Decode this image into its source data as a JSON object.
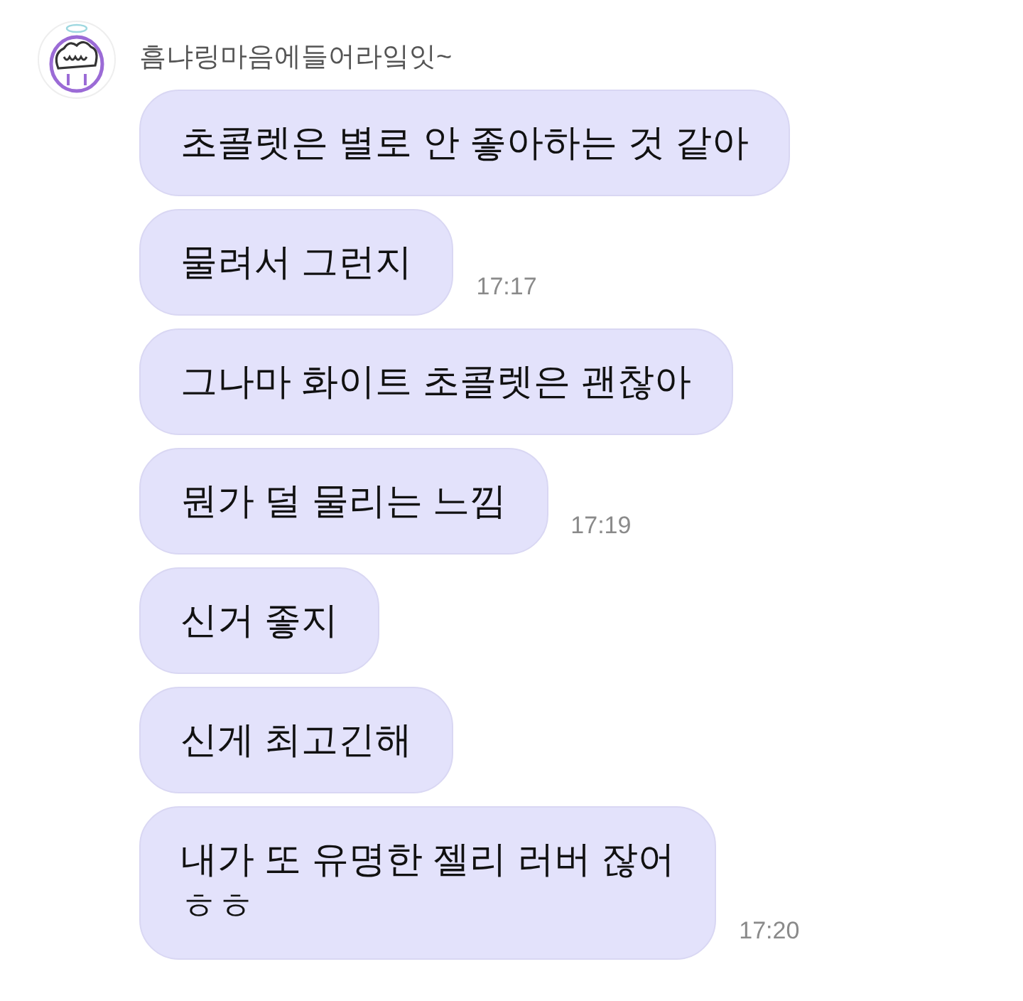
{
  "sender": {
    "name": "흠냐링마음에들어라잌잇~"
  },
  "messages": [
    {
      "text": "초콜렛은 별로 안 좋아하는 것 같아"
    },
    {
      "text": "물려서 그런지",
      "time": "17:17"
    },
    {
      "text": "그나마 화이트 초콜렛은 괜찮아"
    },
    {
      "text": "뭔가 덜 물리는 느낌",
      "time": "17:19"
    },
    {
      "text": "신거 좋지"
    },
    {
      "text": "신게 최고긴해"
    },
    {
      "text": "내가 또 유명한 젤리 러버 잖어\nㅎㅎ",
      "time": "17:20"
    }
  ]
}
